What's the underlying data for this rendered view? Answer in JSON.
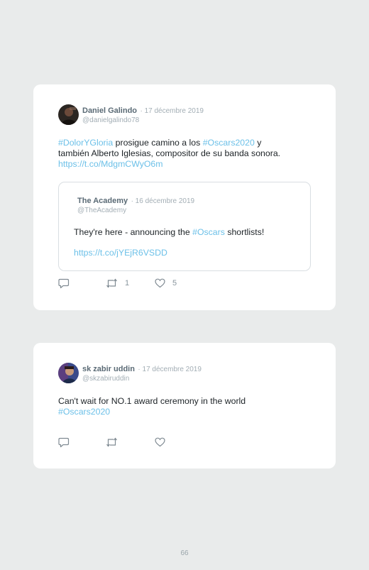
{
  "tweets": [
    {
      "author": "Daniel Galindo",
      "date": "· 17 décembre 2019",
      "handle": "@danielgalindo78",
      "text_parts": {
        "l1_tag": "#DolorYGloria",
        "l1_a": " prosigue camino a los ",
        "l1_tag2": "#Oscars2020",
        "l1_b": " y",
        "l2": "también Alberto Iglesias, compositor de su banda sonora.",
        "l3_link": "https://t.co/MdgmCWyO6m"
      },
      "quote": {
        "author": "The Academy",
        "date": "· 16 décembre 2019",
        "handle": "@TheAcademy",
        "text_a": "They're here - announcing the ",
        "text_tag": "#Oscars",
        "text_b": " shortlists!",
        "link": "https://t.co/jYEjR6VSDD"
      },
      "retweets": "1",
      "likes": "5"
    },
    {
      "author": "sk zabir uddin",
      "date": "· 17 décembre 2019",
      "handle": "@skzabiruddin",
      "text_line1": "Can't wait for NO.1 award ceremony in the world",
      "text_tag": "#Oscars2020"
    }
  ],
  "colors": {
    "background": "#e9ebeb",
    "card": "#ffffff",
    "link": "#6cc0e8",
    "muted": "#a3aeb5"
  },
  "icons": [
    "reply-icon",
    "retweet-icon",
    "heart-icon"
  ],
  "page_number": "66"
}
